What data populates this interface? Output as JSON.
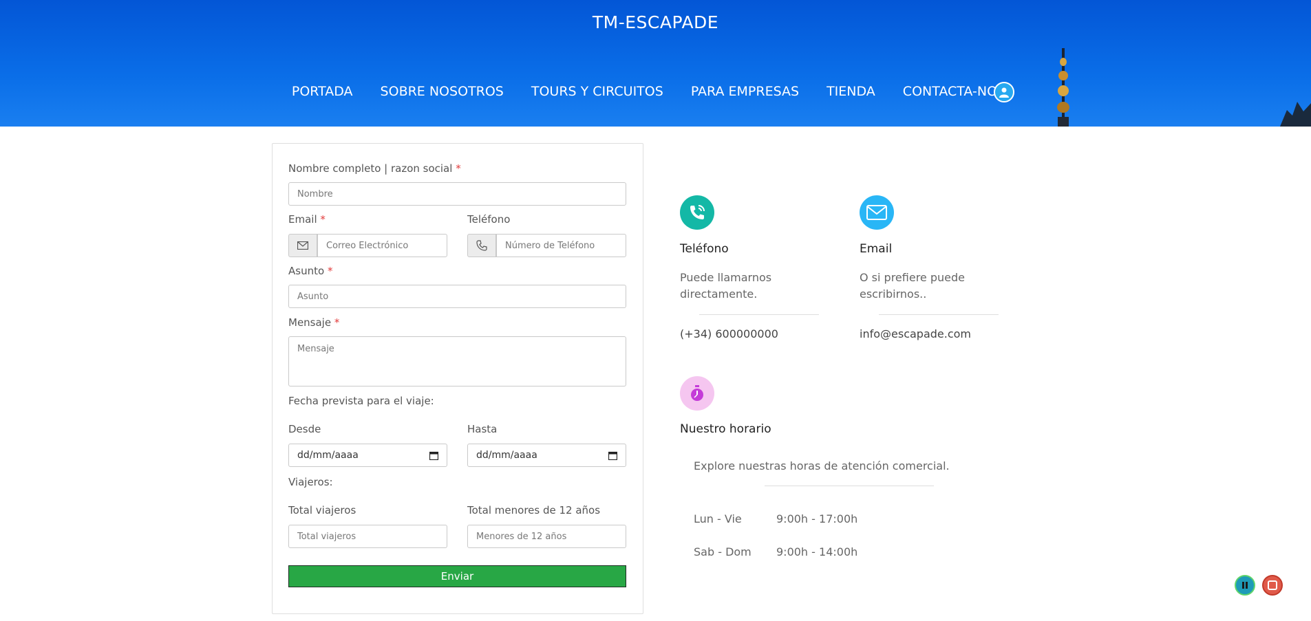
{
  "header": {
    "brand": "TM-ESCAPADE",
    "nav": [
      "PORTADA",
      "SOBRE NOSOTROS",
      "TOURS Y CIRCUITOS",
      "PARA EMPRESAS",
      "TIENDA",
      "CONTACTA-NOS"
    ]
  },
  "form": {
    "name_label": "Nombre completo | razon social",
    "name_placeholder": "Nombre",
    "email_label": "Email",
    "email_placeholder": "Correo Electrónico",
    "phone_label": "Teléfono",
    "phone_placeholder": "Número de Teléfono",
    "subject_label": "Asunto",
    "subject_placeholder": "Asunto",
    "message_label": "Mensaje",
    "message_placeholder": "Mensaje",
    "dates_heading": "Fecha prevista para el viaje:",
    "from_label": "Desde",
    "to_label": "Hasta",
    "date_placeholder": "dd/mm/aaaa",
    "travelers_heading": "Viajeros:",
    "total_label": "Total viajeros",
    "total_placeholder": "Total viajeros",
    "minors_label": "Total menores de 12 años",
    "minors_placeholder": "Menores de 12 años",
    "required_mark": "*",
    "submit": "Enviar"
  },
  "contact": {
    "phone_title": "Teléfono",
    "phone_text_1": "Puede llamarnos",
    "phone_text_2": "directamente.",
    "phone_value": "(+34) 600000000",
    "email_title": "Email",
    "email_text_1": "O si prefiere puede",
    "email_text_2": "escribirnos..",
    "email_value": "info@escapade.com",
    "hours_title": "Nuestro horario",
    "hours_text": "Explore nuestras horas de atención comercial.",
    "hours": [
      {
        "days": "Lun - Vie",
        "time": "9:00h - 17:00h"
      },
      {
        "days": "Sab - Dom",
        "time": "9:00h - 14:00h"
      }
    ]
  },
  "colors": {
    "header_blue": "#0a6ee8",
    "submit_green": "#28a745",
    "phone_icon": "#14b8a6",
    "email_icon": "#29b6f6",
    "clock_icon": "#f5c6f0",
    "pause_button": "#1e9bb8",
    "stop_button": "#e05a4a"
  }
}
